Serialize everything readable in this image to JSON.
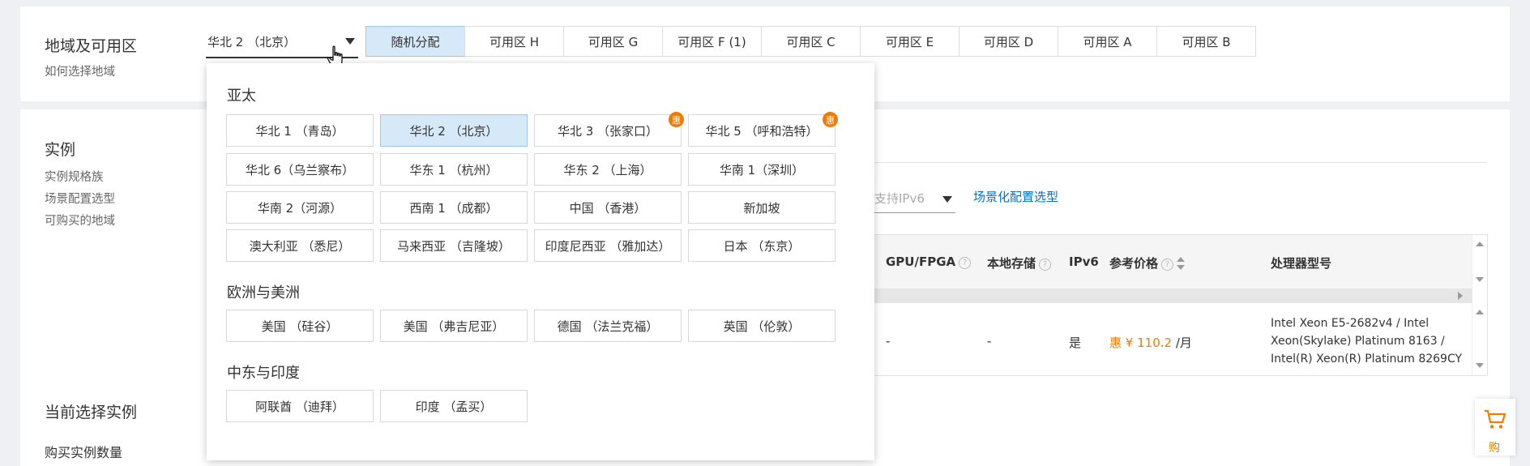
{
  "region_section": {
    "title": "地域及可用区",
    "help_link": "如何选择地域",
    "selected_region": "华北 2 （北京）",
    "zone_tabs": [
      "随机分配",
      "可用区 H",
      "可用区 G",
      "可用区 F (1)",
      "可用区 C",
      "可用区 E",
      "可用区 D",
      "可用区 A",
      "可用区 B"
    ],
    "active_zone": "随机分配"
  },
  "region_dropdown": {
    "groups": [
      {
        "title": "亚太",
        "items": [
          {
            "label": "华北 1 （青岛）",
            "badge": ""
          },
          {
            "label": "华北 2 （北京）",
            "badge": "",
            "selected": true
          },
          {
            "label": "华北 3 （张家口）",
            "badge": "惠"
          },
          {
            "label": "华北 5 （呼和浩特）",
            "badge": "惠"
          },
          {
            "label": "华北 6（乌兰察布）",
            "badge": ""
          },
          {
            "label": "华东 1 （杭州）",
            "badge": ""
          },
          {
            "label": "华东 2 （上海）",
            "badge": ""
          },
          {
            "label": "华南 1（深圳）",
            "badge": ""
          },
          {
            "label": "华南 2（河源）",
            "badge": ""
          },
          {
            "label": "西南 1 （成都）",
            "badge": ""
          },
          {
            "label": "中国 （香港）",
            "badge": ""
          },
          {
            "label": "新加坡",
            "badge": ""
          },
          {
            "label": "澳大利亚 （悉尼）",
            "badge": ""
          },
          {
            "label": "马来西亚 （吉隆坡）",
            "badge": ""
          },
          {
            "label": "印度尼西亚 （雅加达）",
            "badge": ""
          },
          {
            "label": "日本 （东京）",
            "badge": ""
          }
        ]
      },
      {
        "title": "欧洲与美洲",
        "items": [
          {
            "label": "美国 （硅谷）",
            "badge": ""
          },
          {
            "label": "美国 （弗吉尼亚）",
            "badge": ""
          },
          {
            "label": "德国 （法兰克福）",
            "badge": ""
          },
          {
            "label": "英国 （伦敦）",
            "badge": ""
          }
        ]
      },
      {
        "title": "中东与印度",
        "items": [
          {
            "label": "阿联酋 （迪拜）",
            "badge": ""
          },
          {
            "label": "印度 （孟买）",
            "badge": ""
          }
        ]
      }
    ]
  },
  "instance_section": {
    "title": "实例",
    "links": [
      "实例规格族",
      "场景配置选型",
      "可购买的地域"
    ],
    "ipv6_filter": "支持IPv6",
    "scene_link": "场景化配置选型",
    "table": {
      "headers": {
        "gpu": "GPU/FPGA",
        "local_storage": "本地存储",
        "ipv6": "IPv6",
        "price": "参考价格",
        "cpu": "处理器型号"
      },
      "row": {
        "gpu": "-",
        "local_storage": "-",
        "ipv6": "是",
        "price_prefix": "惠",
        "price": "¥ 110.2",
        "price_unit": "/月",
        "cpu": [
          "Intel Xeon E5-2682v4 / Intel",
          "Xeon(Skylake) Platinum 8163 /",
          "Intel(R) Xeon(R) Platinum 8269CY"
        ]
      }
    }
  },
  "current_selection": {
    "title": "当前选择实例",
    "next_label": "购买实例数量"
  },
  "cart": {
    "label": "购"
  },
  "colors": {
    "accent": "#0070cc",
    "promo": "#f17b00",
    "selected_bg": "#d6e9f8"
  }
}
